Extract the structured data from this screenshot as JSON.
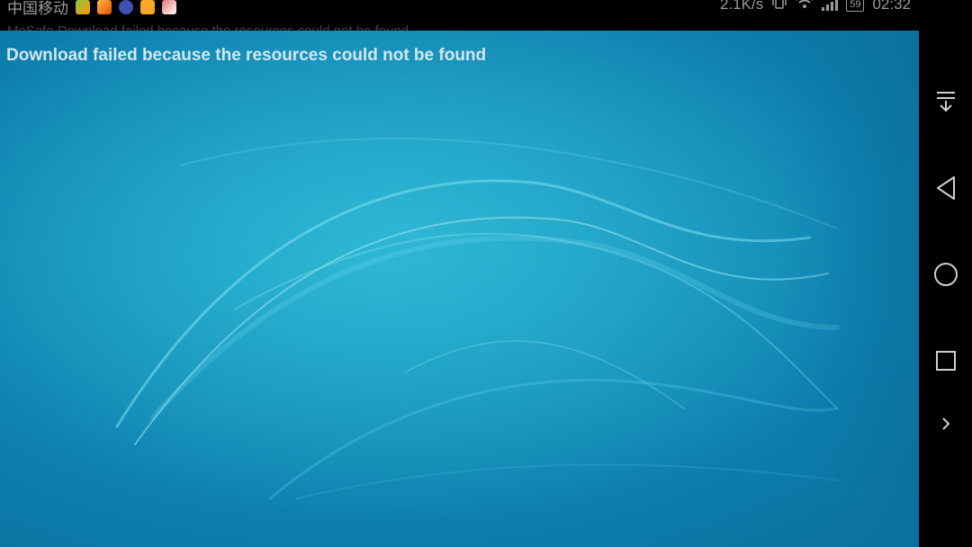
{
  "status_bar": {
    "carrier": "中国移动",
    "net_speed": "2.1K/s",
    "battery": "59",
    "time": "02:32",
    "notification_preview": "MoSafe Download failed because the resources could not be found"
  },
  "toast": {
    "message": "Download failed because the resources could not be found"
  },
  "colors": {
    "wallpaper_base": "#1592bb",
    "wallpaper_light": "#35c3dc",
    "status_text": "#9a9a9a",
    "toast_text": "#d3e6ee"
  },
  "nav_bar": {
    "icons": [
      "notification-pulldown-icon",
      "back-icon",
      "home-icon",
      "recents-icon",
      "expand-icon"
    ]
  }
}
